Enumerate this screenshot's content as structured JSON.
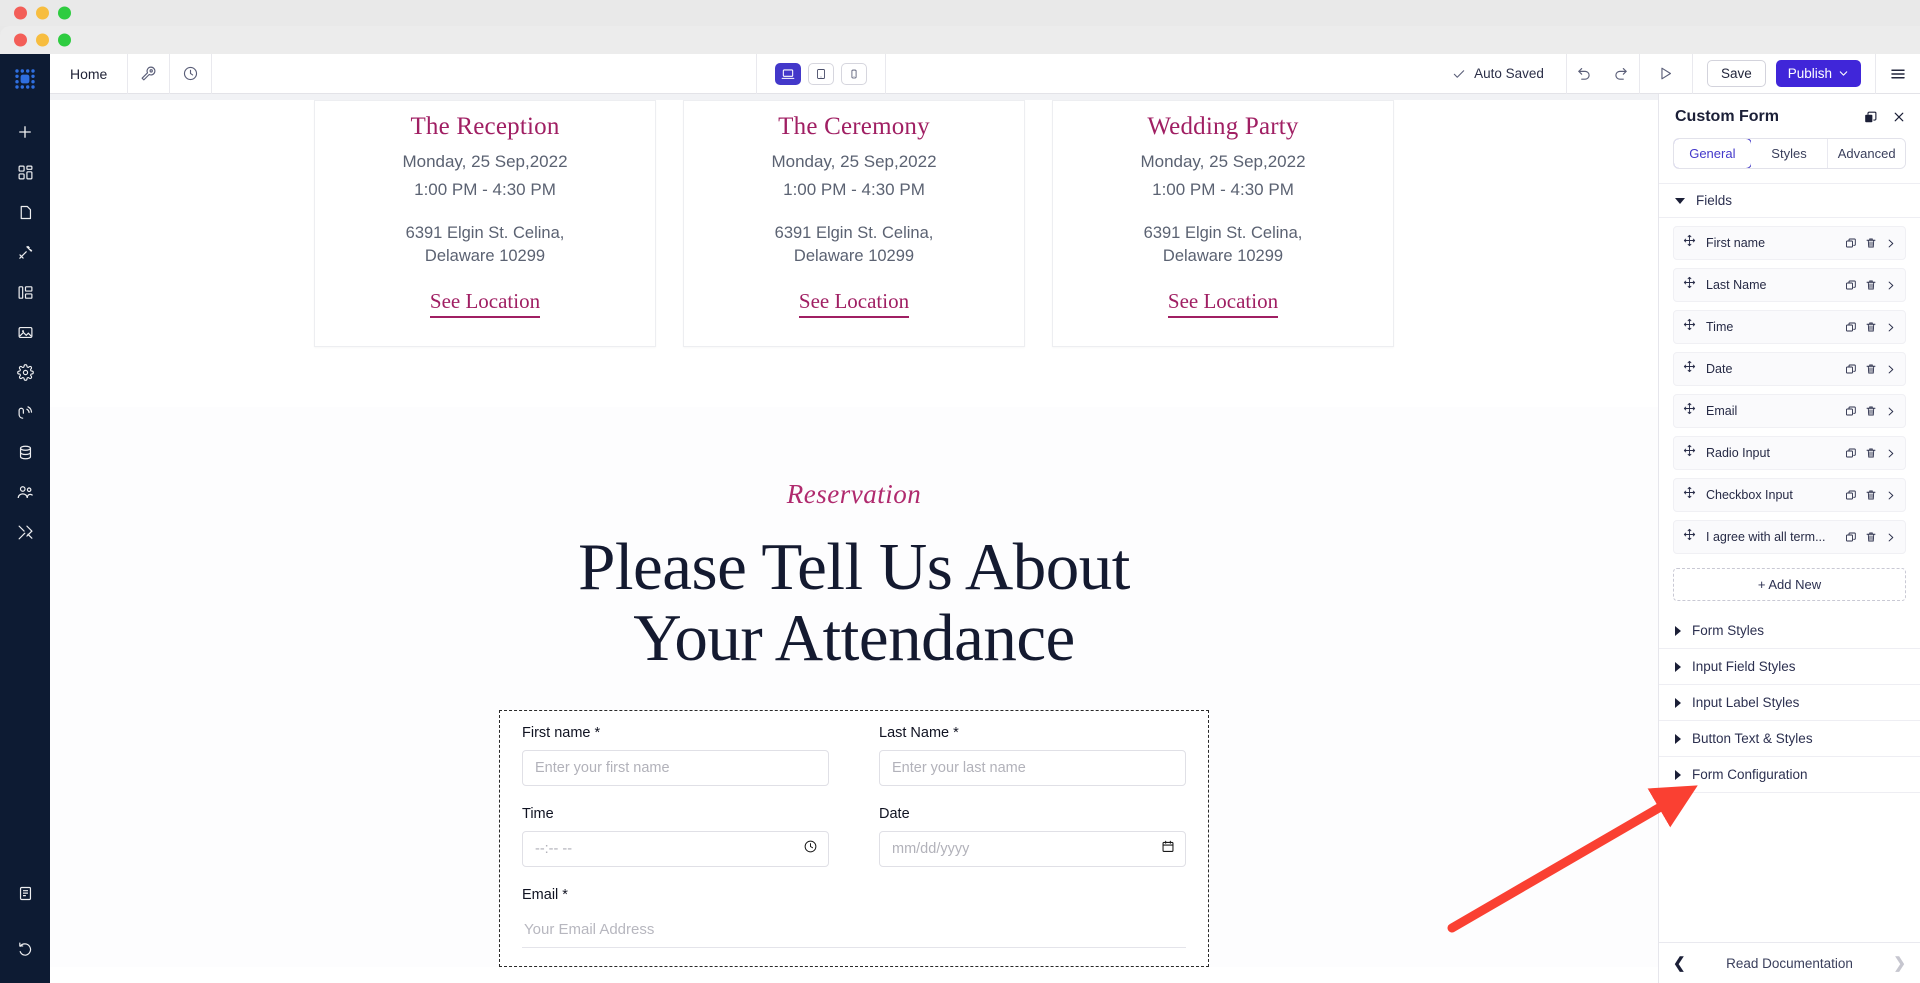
{
  "window": {
    "traffic_lights": [
      "close",
      "minimize",
      "maximize"
    ]
  },
  "toolbar": {
    "home_label": "Home",
    "wrench_icon": "wrench-icon",
    "history_icon": "clock-history-icon",
    "devices": [
      {
        "name": "desktop",
        "icon": "desktop-icon",
        "active": true
      },
      {
        "name": "tablet",
        "icon": "tablet-icon",
        "active": false
      },
      {
        "name": "mobile",
        "icon": "mobile-icon",
        "active": false
      }
    ],
    "autosaved_label": "Auto Saved",
    "undo_icon": "undo-icon",
    "redo_icon": "redo-icon",
    "preview_icon": "play-preview-icon",
    "save_label": "Save",
    "publish_label": "Publish",
    "menu_icon": "hamburger-menu-icon"
  },
  "rail": {
    "logo": "grid-logo-icon",
    "items": [
      {
        "name": "add",
        "icon": "plus-icon"
      },
      {
        "name": "blocks",
        "icon": "blocks-icon"
      },
      {
        "name": "pages",
        "icon": "page-icon"
      },
      {
        "name": "theme",
        "icon": "magic-wand-icon"
      },
      {
        "name": "structure",
        "icon": "sitemap-icon"
      },
      {
        "name": "media",
        "icon": "image-icon"
      },
      {
        "name": "settings",
        "icon": "gear-icon"
      },
      {
        "name": "interactions",
        "icon": "signal-icon"
      },
      {
        "name": "data",
        "icon": "database-icon"
      },
      {
        "name": "users",
        "icon": "users-icon"
      },
      {
        "name": "tools",
        "icon": "tools-icon"
      }
    ],
    "bottom_items": [
      {
        "name": "docs",
        "icon": "book-icon"
      },
      {
        "name": "history",
        "icon": "revert-clock-icon"
      }
    ]
  },
  "canvas": {
    "cards": [
      {
        "title": "The Reception",
        "date": "Monday, 25 Sep,2022",
        "time": "1:00 PM - 4:30 PM",
        "address_line1": "6391 Elgin St. Celina,",
        "address_line2": "Delaware 10299",
        "link": "See Location"
      },
      {
        "title": "The Ceremony",
        "date": "Monday, 25 Sep,2022",
        "time": "1:00 PM - 4:30 PM",
        "address_line1": "6391 Elgin St. Celina,",
        "address_line2": "Delaware 10299",
        "link": "See Location"
      },
      {
        "title": "Wedding Party",
        "date": "Monday, 25 Sep,2022",
        "time": "1:00 PM - 4:30 PM",
        "address_line1": "6391 Elgin St. Celina,",
        "address_line2": "Delaware 10299",
        "link": "See Location"
      }
    ],
    "reservation_script": "Reservation",
    "heading_line1": "Please Tell Us About",
    "heading_line2": "Your Attendance",
    "form": {
      "first_name": {
        "label": "First name *",
        "placeholder": "Enter your first name",
        "value": ""
      },
      "last_name": {
        "label": "Last Name *",
        "placeholder": "Enter your last name",
        "value": ""
      },
      "time": {
        "label": "Time",
        "placeholder": "--:-- --",
        "value": "",
        "icon": "clock-icon"
      },
      "date": {
        "label": "Date",
        "placeholder": "mm/dd/yyyy",
        "value": "",
        "icon": "calendar-icon"
      },
      "email": {
        "label": "Email *",
        "placeholder": "Your Email Address",
        "value": ""
      }
    }
  },
  "panel": {
    "title": "Custom Form",
    "duplicate_icon": "copy-layers-icon",
    "close_icon": "close-icon",
    "tabs": [
      {
        "label": "General",
        "active": true
      },
      {
        "label": "Styles",
        "active": false
      },
      {
        "label": "Advanced",
        "active": false
      }
    ],
    "fields_section_label": "Fields",
    "fields": [
      {
        "label": "First name"
      },
      {
        "label": "Last Name"
      },
      {
        "label": "Time"
      },
      {
        "label": "Date"
      },
      {
        "label": "Email"
      },
      {
        "label": "Radio Input"
      },
      {
        "label": "Checkbox Input"
      },
      {
        "label": "I agree with all term..."
      }
    ],
    "add_new_label": "+ Add New",
    "sections": [
      {
        "label": "Form Styles"
      },
      {
        "label": "Input Field Styles"
      },
      {
        "label": "Input Label Styles"
      },
      {
        "label": "Button Text & Styles"
      },
      {
        "label": "Form Configuration"
      }
    ],
    "footer": {
      "prev_icon": "chevron-left-icon",
      "label": "Read Documentation",
      "next_icon": "chevron-right-icon"
    }
  },
  "annotation": {
    "arrow_color": "#fa4032",
    "points_to": "Form Configuration"
  },
  "colors": {
    "accent_purple": "#4026d9",
    "brand_pink": "#a01f63",
    "rail_dark": "#0d1b33",
    "annotation_red": "#fa4032"
  }
}
